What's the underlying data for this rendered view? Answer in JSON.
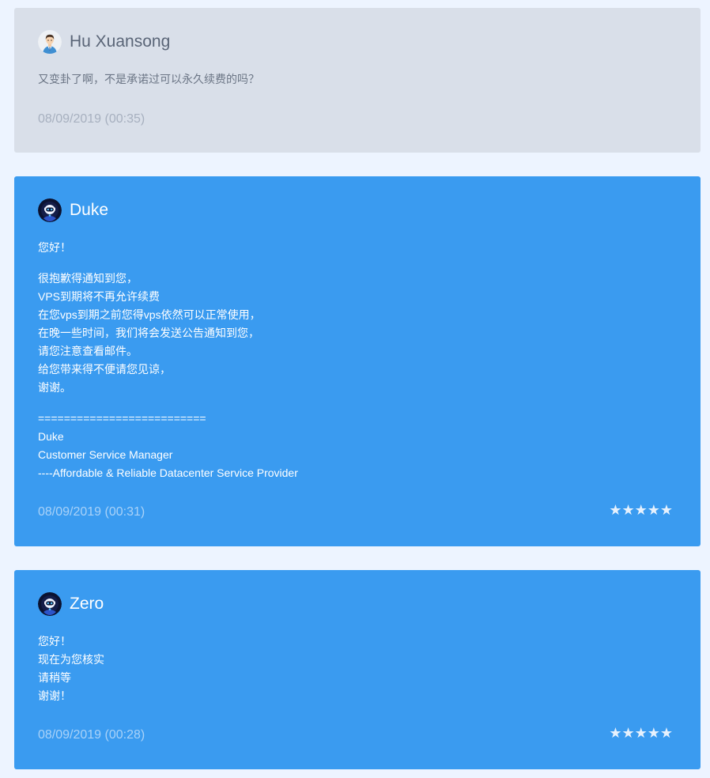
{
  "messages": [
    {
      "author": "Hu Xuansong",
      "role": "user",
      "avatar_icon": "user-avatar-icon",
      "paragraphs": [
        [
          "又变卦了啊，不是承诺过可以永久续费的吗？"
        ]
      ],
      "timestamp": "08/09/2019 (00:35)"
    },
    {
      "author": "Duke",
      "role": "staff",
      "avatar_icon": "robot-avatar-icon",
      "paragraphs": [
        [
          "您好！"
        ],
        [
          "很抱歉得通知到您，",
          "VPS到期将不再允许续费",
          "在您vps到期之前您得vps依然可以正常使用，",
          "在晚一些时间，我们将会发送公告通知到您，",
          "请您注意查看邮件。",
          "给您带来得不便请您见谅，",
          "谢谢。"
        ],
        [
          "==========================",
          "Duke",
          "Customer Service Manager",
          "----Affordable & Reliable Datacenter Service Provider"
        ]
      ],
      "timestamp": "08/09/2019 (00:31)",
      "rating": "★★★★★"
    },
    {
      "author": "Zero",
      "role": "staff",
      "avatar_icon": "robot-avatar-icon",
      "paragraphs": [
        [
          "您好！",
          "现在为您核实",
          "请稍等",
          "谢谢！"
        ]
      ],
      "timestamp": "08/09/2019 (00:28)",
      "rating": "★★★★★"
    }
  ],
  "colors": {
    "page_background": "#edf4ff",
    "user_card": "#d9dfe9",
    "staff_card": "#3a9bf0"
  }
}
